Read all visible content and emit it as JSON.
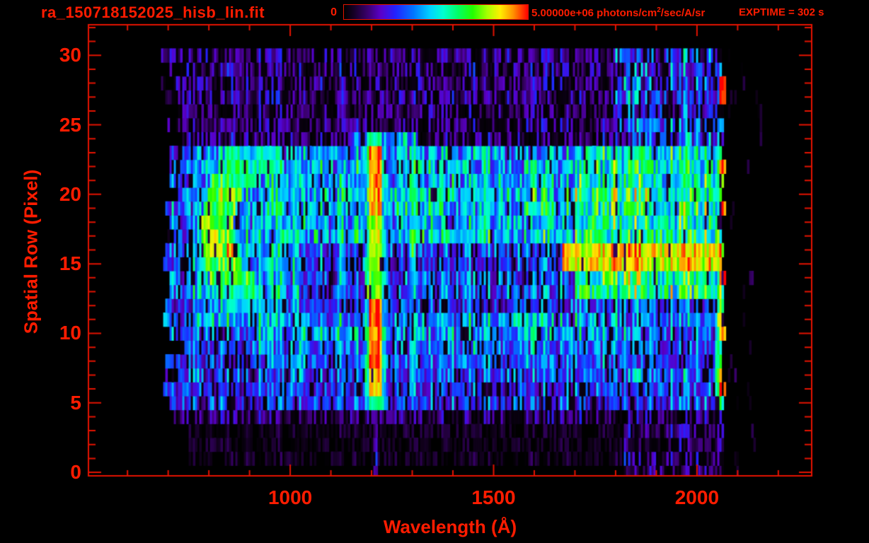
{
  "colors": {
    "text_red": "#ff1c00",
    "axis_red": "#e41300",
    "background": "#000000"
  },
  "header": {
    "title": "ra_150718152025_hisb_lin.fit",
    "colorbar": {
      "min_label": "0",
      "max_value": "5.00000e+06",
      "units_pre": " photons/cm",
      "units_sup": "2",
      "units_post": "/sec/A/sr"
    },
    "exptime": "EXPTIME = 302 s"
  },
  "chart_data": {
    "type": "heatmap",
    "title": "ra_150718152025_hisb_lin.fit",
    "xlabel": "Wavelength (Å)",
    "ylabel": "Spatial Row (Pixel)",
    "xlim": [
      504,
      2282
    ],
    "ylim": [
      -0.25,
      32.2
    ],
    "x_major_ticks": [
      1000,
      1500,
      2000
    ],
    "x_minor_step": 100,
    "y_major_ticks": [
      0,
      5,
      10,
      15,
      20,
      25,
      30
    ],
    "y_minor_step": 1,
    "grid": false,
    "exposure_seconds": 302,
    "colorbar": {
      "min": 0,
      "max": 5000000,
      "units": "photons/cm^2/sec/A/sr",
      "orientation": "horizontal"
    },
    "colormap": [
      {
        "t": 0.0,
        "c": "#000000"
      },
      {
        "t": 0.05,
        "c": "#140022"
      },
      {
        "t": 0.13,
        "c": "#3a006e"
      },
      {
        "t": 0.2,
        "c": "#5a00c8"
      },
      {
        "t": 0.28,
        "c": "#2222ff"
      },
      {
        "t": 0.38,
        "c": "#0077ff"
      },
      {
        "t": 0.47,
        "c": "#00d4ff"
      },
      {
        "t": 0.54,
        "c": "#00ffd0"
      },
      {
        "t": 0.62,
        "c": "#00ff66"
      },
      {
        "t": 0.7,
        "c": "#22ff00"
      },
      {
        "t": 0.78,
        "c": "#a8ff00"
      },
      {
        "t": 0.85,
        "c": "#ffee00"
      },
      {
        "t": 0.92,
        "c": "#ff9100"
      },
      {
        "t": 1.0,
        "c": "#ff0000"
      }
    ],
    "data_extent": {
      "lambda_A": [
        680,
        2075
      ],
      "rows": [
        0,
        30
      ]
    },
    "features": [
      {
        "name": "top-noise-band",
        "rows": [
          24,
          30
        ],
        "lambda": [
          680,
          2068
        ],
        "intensity": 0.15,
        "speckle": 1.0
      },
      {
        "name": "top-right-bright-noise",
        "rows": [
          24,
          30
        ],
        "lambda": [
          1800,
          2068
        ],
        "intensity": 0.3,
        "speckle": 1.0
      },
      {
        "name": "main-spectral-band",
        "rows": [
          5,
          23
        ],
        "lambda": [
          690,
          2068
        ],
        "intensity": 0.28,
        "speckle": 0.85
      },
      {
        "name": "upper-cyan-band",
        "rows": [
          17,
          23
        ],
        "lambda": [
          880,
          1770
        ],
        "intensity": 0.44,
        "speckle": 0.65
      },
      {
        "name": "lower-cyan-band",
        "rows": [
          8,
          11
        ],
        "lambda": [
          900,
          1780
        ],
        "intensity": 0.37,
        "speckle": 0.7
      },
      {
        "name": "right-green-region",
        "rows": [
          13,
          23
        ],
        "lambda": [
          1700,
          2066
        ],
        "intensity": 0.58,
        "speckle": 0.5
      },
      {
        "name": "right-lower-region",
        "rows": [
          6,
          12
        ],
        "lambda": [
          1690,
          2066
        ],
        "intensity": 0.34,
        "speckle": 0.75
      },
      {
        "name": "bright-horizontal-streak",
        "rows": [
          15,
          16
        ],
        "lambda": [
          1670,
          2062
        ],
        "intensity": 0.85,
        "speckle": 0.2
      },
      {
        "name": "bottom-dense-noise-row",
        "rows": [
          4,
          4
        ],
        "lambda": [
          700,
          2062
        ],
        "intensity": 0.13,
        "speckle": 1.0
      },
      {
        "name": "bottom-sparse-noise",
        "rows": [
          1,
          3
        ],
        "lambda": [
          750,
          2062
        ],
        "intensity": 0.06,
        "speckle": 1.0
      },
      {
        "name": "bottom-right-noise",
        "rows": [
          0,
          4
        ],
        "lambda": [
          1820,
          2068
        ],
        "intensity": 0.15,
        "speckle": 1.0
      },
      {
        "name": "beyond-edge-specks",
        "rows": [
          0,
          30
        ],
        "lambda": [
          2075,
          2160
        ],
        "intensity": 0.08,
        "speckle": 1.0
      },
      {
        "name": "arc-halo",
        "rows": [
          11,
          23
        ],
        "lambda": [
          760,
          990
        ],
        "intensity": 0.42,
        "speckle": 0.55
      },
      {
        "name": "arc-row23",
        "rows": [
          23,
          23
        ],
        "lambda": [
          840,
          975
        ],
        "intensity": 0.55,
        "speckle": 0.3
      },
      {
        "name": "arc-row22",
        "rows": [
          22,
          22
        ],
        "lambda": [
          825,
          965
        ],
        "intensity": 0.62,
        "speckle": 0.3
      },
      {
        "name": "arc-row21",
        "rows": [
          21,
          21
        ],
        "lambda": [
          810,
          925
        ],
        "intensity": 0.62,
        "speckle": 0.3
      },
      {
        "name": "arc-row20",
        "rows": [
          20,
          20
        ],
        "lambda": [
          797,
          881
        ],
        "intensity": 0.66,
        "speckle": 0.3
      },
      {
        "name": "arc-row19",
        "rows": [
          19,
          19
        ],
        "lambda": [
          788,
          867
        ],
        "intensity": 0.7,
        "speckle": 0.3
      },
      {
        "name": "arc-row18",
        "rows": [
          18,
          18
        ],
        "lambda": [
          782,
          860
        ],
        "intensity": 0.73,
        "speckle": 0.3
      },
      {
        "name": "arc-row17",
        "rows": [
          17,
          17
        ],
        "lambda": [
          779,
          855
        ],
        "intensity": 0.73,
        "speckle": 0.3
      },
      {
        "name": "arc-row16",
        "rows": [
          16,
          16
        ],
        "lambda": [
          781,
          861
        ],
        "intensity": 0.73,
        "speckle": 0.3
      },
      {
        "name": "arc-row15",
        "rows": [
          15,
          15
        ],
        "lambda": [
          787,
          880
        ],
        "intensity": 0.69,
        "speckle": 0.3
      },
      {
        "name": "arc-row14",
        "rows": [
          14,
          14
        ],
        "lambda": [
          800,
          910
        ],
        "intensity": 0.64,
        "speckle": 0.3
      },
      {
        "name": "arc-row13",
        "rows": [
          13,
          13
        ],
        "lambda": [
          817,
          937
        ],
        "intensity": 0.57,
        "speckle": 0.3
      },
      {
        "name": "arc-row12",
        "rows": [
          12,
          12
        ],
        "lambda": [
          835,
          957
        ],
        "intensity": 0.47,
        "speckle": 0.3
      },
      {
        "name": "emission-stripe-1015-upper",
        "rows": [
          11,
          23
        ],
        "lambda": [
          1004,
          1024
        ],
        "intensity": 0.52,
        "speckle": 0.45
      },
      {
        "name": "emission-stripe-1015-lower",
        "rows": [
          6,
          10
        ],
        "lambda": [
          1000,
          1032
        ],
        "intensity": 0.44,
        "speckle": 0.5
      },
      {
        "name": "lyman-alpha-halo",
        "rows": [
          5,
          23
        ],
        "lambda": [
          1184,
          1236
        ],
        "intensity": 0.5,
        "speckle": 0.45
      },
      {
        "name": "lyman-alpha-top-row24",
        "rows": [
          24,
          24
        ],
        "lambda": [
          1150,
          1320
        ],
        "intensity": 0.4,
        "speckle": 0.7
      },
      {
        "name": "lyman-alpha-core-row24",
        "rows": [
          24,
          24
        ],
        "lambda": [
          1195,
          1224
        ],
        "intensity": 0.58,
        "speckle": 0.15
      },
      {
        "name": "lyman-alpha-core-rows21-23",
        "rows": [
          21,
          23
        ],
        "lambda": [
          1195,
          1224
        ],
        "intensity": 0.95,
        "speckle": 0.15
      },
      {
        "name": "lyman-alpha-core-rows19-20",
        "rows": [
          19,
          20
        ],
        "lambda": [
          1195,
          1224
        ],
        "intensity": 0.88,
        "speckle": 0.15
      },
      {
        "name": "lyman-alpha-core-rows16-18",
        "rows": [
          16,
          18
        ],
        "lambda": [
          1195,
          1224
        ],
        "intensity": 0.8,
        "speckle": 0.15
      },
      {
        "name": "lyman-alpha-core-rows13-15",
        "rows": [
          13,
          15
        ],
        "lambda": [
          1195,
          1224
        ],
        "intensity": 0.72,
        "speckle": 0.15
      },
      {
        "name": "lyman-alpha-core-rows7-12",
        "rows": [
          7,
          12
        ],
        "lambda": [
          1195,
          1224
        ],
        "intensity": 0.95,
        "speckle": 0.15
      },
      {
        "name": "lyman-alpha-core-row6",
        "rows": [
          6,
          6
        ],
        "lambda": [
          1195,
          1224
        ],
        "intensity": 0.88,
        "speckle": 0.15
      },
      {
        "name": "lyman-alpha-core-row5",
        "rows": [
          5,
          5
        ],
        "lambda": [
          1195,
          1224
        ],
        "intensity": 0.6,
        "speckle": 0.2
      },
      {
        "name": "lyman-alpha-tail",
        "rows": [
          0,
          4
        ],
        "lambda": [
          1203,
          1216
        ],
        "intensity": 0.2,
        "speckle": 0.95
      },
      {
        "name": "emission-stripe-1300-upper",
        "rows": [
          16,
          23
        ],
        "lambda": [
          1292,
          1309
        ],
        "intensity": 0.56,
        "speckle": 0.4
      },
      {
        "name": "emission-stripe-1300-lower",
        "rows": [
          6,
          15
        ],
        "lambda": [
          1292,
          1309
        ],
        "intensity": 0.42,
        "speckle": 0.55
      },
      {
        "name": "emission-stripe-1356",
        "rows": [
          17,
          23
        ],
        "lambda": [
          1350,
          1363
        ],
        "intensity": 0.46,
        "speckle": 0.5
      },
      {
        "name": "emission-stripe-1480-upper",
        "rows": [
          17,
          23
        ],
        "lambda": [
          1471,
          1489
        ],
        "intensity": 0.52,
        "speckle": 0.45
      },
      {
        "name": "emission-stripe-1480-lower",
        "rows": [
          8,
          11
        ],
        "lambda": [
          1471,
          1489
        ],
        "intensity": 0.4,
        "speckle": 0.55
      },
      {
        "name": "emission-stripe-1550",
        "rows": [
          17,
          22
        ],
        "lambda": [
          1544,
          1557
        ],
        "intensity": 0.42,
        "speckle": 0.55
      },
      {
        "name": "right-edge-green-column",
        "rows": [
          5,
          23
        ],
        "lambda": [
          2046,
          2066
        ],
        "intensity": 0.6,
        "speckle": 0.5
      },
      {
        "name": "edge-hotspot-rows27-28",
        "rows": [
          27,
          28
        ],
        "lambda": [
          2056,
          2072
        ],
        "intensity": 1.0,
        "speckle": 0.2
      },
      {
        "name": "edge-hotspot-row22",
        "rows": [
          22,
          22
        ],
        "lambda": [
          2056,
          2072
        ],
        "intensity": 1.0,
        "speckle": 0.2
      },
      {
        "name": "edge-hotspot-row19",
        "rows": [
          19,
          19
        ],
        "lambda": [
          2056,
          2072
        ],
        "intensity": 0.95,
        "speckle": 0.2
      },
      {
        "name": "edge-hotspot-row14",
        "rows": [
          14,
          14
        ],
        "lambda": [
          2056,
          2072
        ],
        "intensity": 1.0,
        "speckle": 0.2
      },
      {
        "name": "edge-hotspot-row10",
        "rows": [
          10,
          10
        ],
        "lambda": [
          2056,
          2072
        ],
        "intensity": 0.9,
        "speckle": 0.2
      },
      {
        "name": "edge-hotspot-row6",
        "rows": [
          6,
          6
        ],
        "lambda": [
          2056,
          2072
        ],
        "intensity": 0.9,
        "speckle": 0.2
      }
    ],
    "noise": {
      "seed": 20150718,
      "column_gain": [
        0.68,
        1.32
      ],
      "cell_gain": [
        0.35,
        1.65
      ],
      "row_gain": [
        0.8,
        1.2
      ],
      "dropout": {
        "low_v": 0.18,
        "low_p": 0.5,
        "mid_v": 0.35,
        "mid_p": 0.18,
        "high_p": 0.06,
        "factor": 0.12
      },
      "left_edge_jitter": [
        682,
        58
      ],
      "right_edge_jitter": [
        2056,
        16
      ],
      "outside_keep_p": 0.1
    }
  }
}
